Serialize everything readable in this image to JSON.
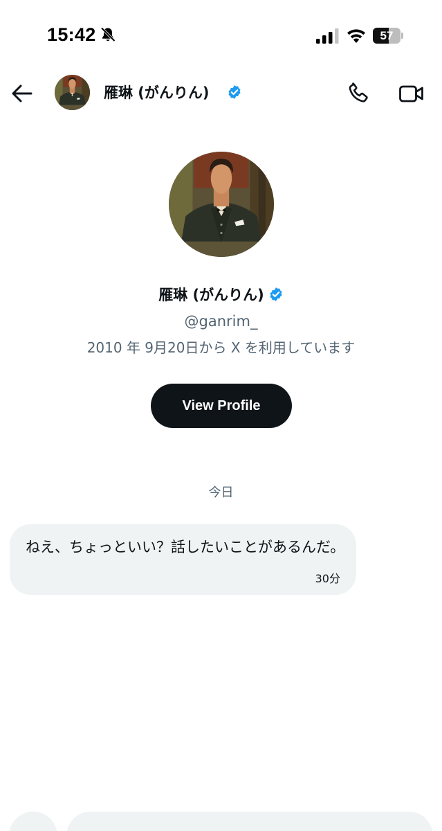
{
  "status_bar": {
    "time": "15:42",
    "battery_level": "57",
    "battery_percent": 57,
    "icons": [
      "bell-slash-icon",
      "cellular-signal-icon",
      "wifi-icon",
      "battery-icon"
    ]
  },
  "header": {
    "display_name": "雁琳 (がんりん)",
    "icons": [
      "back-arrow-icon",
      "verified-badge-icon",
      "phone-icon",
      "video-camera-icon"
    ]
  },
  "profile": {
    "display_name": "雁琳 (がんりん)",
    "handle": "@ganrim_",
    "joined": "2010 年 9月20日から X を利用しています",
    "view_profile_label": "View Profile"
  },
  "conversation": {
    "date_divider": "今日",
    "messages": [
      {
        "text": "ねえ、ちょっといい？話したいことがあるんだ。",
        "time": "30分"
      }
    ]
  },
  "colors": {
    "text_primary": "#0f1419",
    "text_secondary": "#536471",
    "verified_blue": "#1d9bf0",
    "bubble_bg": "#eff3f4",
    "button_bg": "#0f1419"
  }
}
